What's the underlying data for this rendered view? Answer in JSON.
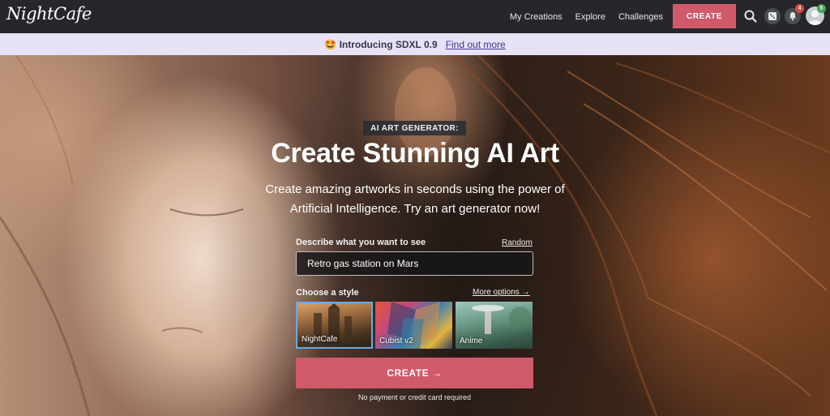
{
  "app": {
    "logo_text": "NightCafe"
  },
  "nav": {
    "links": [
      "My Creations",
      "Explore",
      "Challenges"
    ],
    "create_label": "CREATE",
    "notifications_count": "4",
    "profile_badge_count": "5",
    "icons": {
      "search": "search-icon",
      "dice": "dice-icon",
      "bell": "bell-icon",
      "avatar": "avatar-icon"
    }
  },
  "banner": {
    "emoji": "🤩",
    "title": "Introducing SDXL 0.9",
    "link": "Find out more"
  },
  "hero": {
    "tag": "AI ART GENERATOR:",
    "headline": "Create Stunning AI Art",
    "subtitle": "Create amazing artworks in seconds using the power of Artificial Intelligence. Try an art generator now!"
  },
  "form": {
    "prompt_label": "Describe what you want to see",
    "random_link": "Random",
    "prompt_value": "Retro gas station on Mars",
    "style_label": "Choose a style",
    "more_options": "More options →",
    "styles": [
      {
        "name": "NightCafe",
        "selected": true
      },
      {
        "name": "Cubist v2",
        "selected": false
      },
      {
        "name": "Anime",
        "selected": false
      }
    ],
    "create_label": "CREATE →",
    "footnote": "No payment or credit card required"
  },
  "colors": {
    "accent": "#d15a6a",
    "nav_bg": "#25272b",
    "banner_bg": "#e8e2f7",
    "selected_border": "#6aa9e6"
  }
}
